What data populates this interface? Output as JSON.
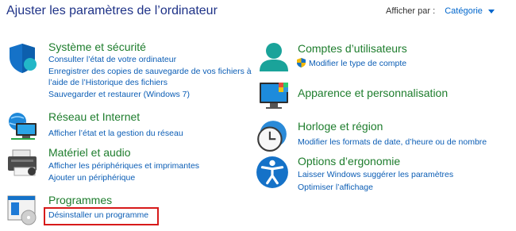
{
  "header": {
    "title": "Ajuster les paramètres de l’ordinateur",
    "view_by_label": "Afficher par :",
    "view_by_value": "Catégorie"
  },
  "categories": {
    "system": {
      "title": "Système et sécurité",
      "links": [
        "Consulter l’état de votre ordinateur",
        "Enregistrer des copies de sauvegarde de vos fichiers à",
        "l’aide de l’Historique des fichiers",
        "Sauvegarder et restaurer (Windows 7)"
      ]
    },
    "network": {
      "title": "Réseau et Internet",
      "links": [
        "Afficher l’état et la gestion du réseau"
      ]
    },
    "hardware": {
      "title": "Matériel et audio",
      "links": [
        "Afficher les périphériques et imprimantes",
        "Ajouter un périphérique"
      ]
    },
    "programs": {
      "title": "Programmes",
      "links": [
        "Désinstaller un programme"
      ]
    },
    "accounts": {
      "title": "Comptes d’utilisateurs",
      "links": [
        "Modifier le type de compte"
      ]
    },
    "appearance": {
      "title": "Apparence et personnalisation"
    },
    "clock": {
      "title": "Horloge et région",
      "links": [
        "Modifier les formats de date, d’heure ou de nombre"
      ]
    },
    "ease": {
      "title": "Options d’ergonomie",
      "links": [
        "Laisser Windows suggérer les paramètres",
        "Optimiser l’affichage"
      ]
    }
  },
  "colors": {
    "title": "#1e3287",
    "category_title": "#1e7d2d",
    "link": "#0b5db5",
    "highlight": "#d71a1a"
  }
}
